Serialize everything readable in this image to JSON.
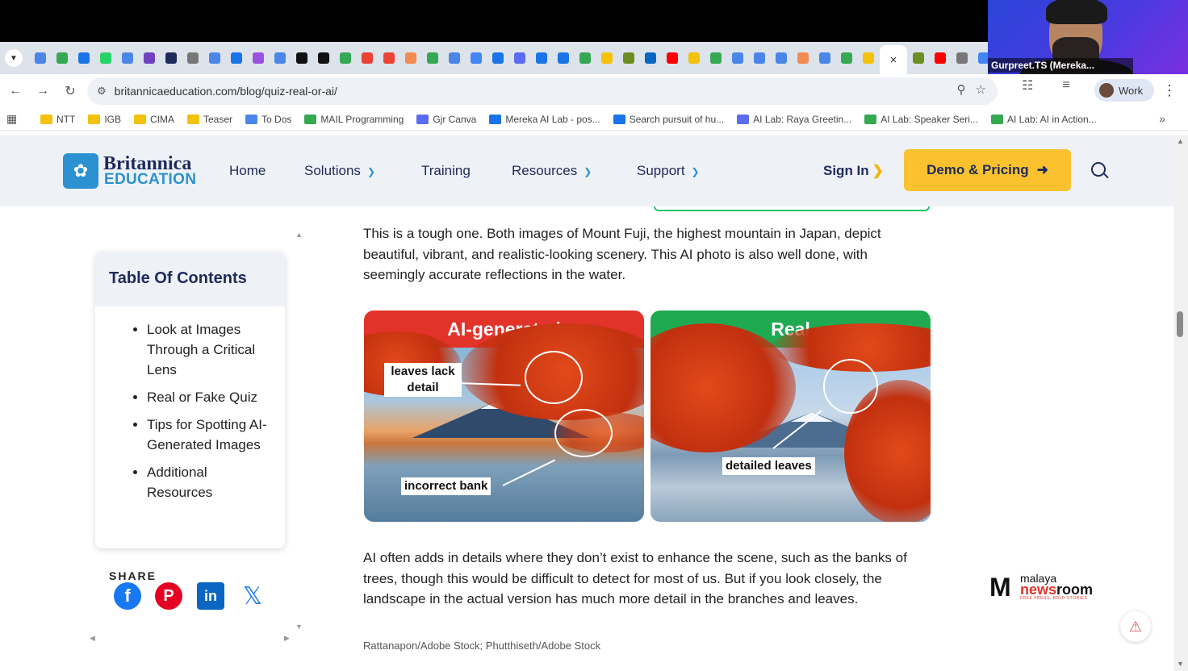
{
  "browser": {
    "url": "britannicaeducation.com/blog/quiz-real-or-ai/",
    "profile_label": "Work",
    "active_tab_close": "×",
    "tab_favicon_colors": [
      "#4a86e8",
      "#34a853",
      "#1a73e8",
      "#25d366",
      "#4a86e8",
      "#6f42c1",
      "#1d2a5a",
      "#777777",
      "#4a86e8",
      "#1a73e8",
      "#9b51e0",
      "#4a86e8",
      "#111111",
      "#111111",
      "#34a853",
      "#ea4335",
      "#ea4335",
      "#f28b52",
      "#34a853",
      "#4a86e8",
      "#4285f4",
      "#1a73e8",
      "#5b6cf0",
      "#1a73e8",
      "#1a73e8",
      "#34a853",
      "#f4c20d",
      "#6b8e23",
      "#0a66c2",
      "#ff0000",
      "#f4c20d",
      "#34a853",
      "#4a86e8",
      "#4a86e8",
      "#4a86e8",
      "#f28b52",
      "#4a86e8",
      "#34a853",
      "#f4c20d"
    ],
    "tab_favicon_colors_right": [
      "#6b8e23",
      "#ff0000",
      "#777777",
      "#4285f4"
    ],
    "bookmarks": [
      {
        "label": "NTT",
        "color": "#f4c20d"
      },
      {
        "label": "IGB",
        "color": "#f4c20d"
      },
      {
        "label": "CIMA",
        "color": "#f4c20d"
      },
      {
        "label": "Teaser",
        "color": "#f4c20d"
      },
      {
        "label": "To Dos",
        "color": "#4a86e8"
      },
      {
        "label": "MAIL Programming",
        "color": "#34a853"
      },
      {
        "label": "Gjr Canva",
        "color": "#5b6cf0"
      },
      {
        "label": "Mereka AI Lab - pos...",
        "color": "#1a73e8"
      },
      {
        "label": "Search pursuit of hu...",
        "color": "#1a73e8"
      },
      {
        "label": "AI Lab: Raya Greetin...",
        "color": "#5b6cf0"
      },
      {
        "label": "AI Lab: Speaker Seri...",
        "color": "#34a853"
      },
      {
        "label": "AI Lab: AI in Action...",
        "color": "#34a853"
      }
    ]
  },
  "webcam": {
    "name": "Gurpreet.TS (Mereka..."
  },
  "site": {
    "logo_line1": "Britannica",
    "logo_line2": "EDUCATION",
    "nav": {
      "home": "Home",
      "solutions": "Solutions",
      "training": "Training",
      "resources": "Resources",
      "support": "Support"
    },
    "sign_in": "Sign In",
    "demo_button": "Demo & Pricing",
    "accent": "#f9c22e",
    "brand_navy": "#1d2a5a",
    "brand_blue": "#2b91d1"
  },
  "toc": {
    "title": "Table Of Contents",
    "items": [
      "Look at Images Through a Critical Lens",
      "Real or Fake Quiz",
      "Tips for Spotting AI-Generated Images",
      "Additional Resources"
    ]
  },
  "share": {
    "label": "SHARE",
    "icons": [
      "facebook-icon",
      "pinterest-icon",
      "linkedin-icon",
      "x-icon"
    ]
  },
  "article": {
    "para1": "This is a tough one. Both images of Mount Fuji, the highest mountain in Japan, depict beautiful, vibrant, and realistic-looking scenery. This AI photo is also well done, with seemingly accurate reflections in the water.",
    "image_ai_label": "AI-generated",
    "image_real_label": "Real",
    "tag_leaves_lack": "leaves lack detail",
    "tag_incorrect_bank": "incorrect bank",
    "tag_detailed_leaves": "detailed leaves",
    "para2": "AI often adds in details where they don’t exist to enhance the scene, such as the banks of trees, though this would be difficult to detect for most of us. But if you look closely, the landscape in the actual version has much more detail in the branches and leaves.",
    "caption": "Rattanapon/Adobe Stock; Phutthiseth/Adobe Stock"
  },
  "watermark": {
    "top": "malaya",
    "news": "news",
    "room": "room",
    "tagline": "FREE PRESS. BOLD STORIES"
  }
}
